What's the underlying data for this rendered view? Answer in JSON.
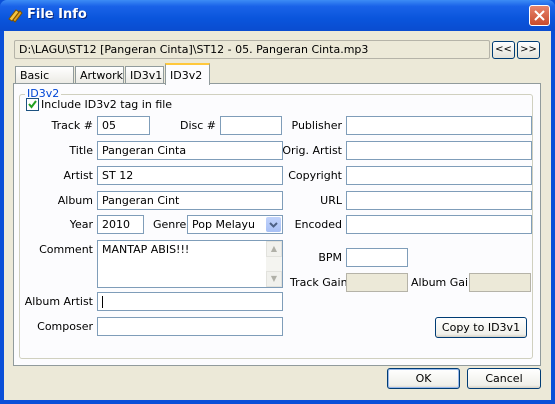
{
  "window": {
    "title": "File Info"
  },
  "path": {
    "value": "D:\\LAGU\\ST12 [Pangeran Cinta]\\ST12 - 05. Pangeran Cinta.mp3"
  },
  "nav": {
    "prev_label": "<<",
    "next_label": ">>"
  },
  "tabs": [
    {
      "label": "Basic Info"
    },
    {
      "label": "Artwork"
    },
    {
      "label": "ID3v1"
    },
    {
      "label": "ID3v2"
    }
  ],
  "active_tab": "ID3v2",
  "group": {
    "label": "ID3v2"
  },
  "include": {
    "label": "Include ID3v2 tag in file",
    "checked": true
  },
  "fields": {
    "track": {
      "label": "Track #",
      "value": "05"
    },
    "disc": {
      "label": "Disc #",
      "value": ""
    },
    "title": {
      "label": "Title",
      "value": "Pangeran Cinta"
    },
    "artist": {
      "label": "Artist",
      "value": "ST 12"
    },
    "album": {
      "label": "Album",
      "value": "Pangeran Cint"
    },
    "year": {
      "label": "Year",
      "value": "2010"
    },
    "genre": {
      "label": "Genre",
      "value": "Pop Melayu"
    },
    "comment": {
      "label": "Comment",
      "value": "MANTAP ABIS!!!"
    },
    "album_artist": {
      "label": "Album Artist",
      "value": ""
    },
    "composer": {
      "label": "Composer",
      "value": ""
    },
    "publisher": {
      "label": "Publisher",
      "value": ""
    },
    "orig_artist": {
      "label": "Orig. Artist",
      "value": ""
    },
    "copyright": {
      "label": "Copyright",
      "value": ""
    },
    "url": {
      "label": "URL",
      "value": ""
    },
    "encoded": {
      "label": "Encoded",
      "value": ""
    },
    "bpm": {
      "label": "BPM",
      "value": ""
    },
    "track_gain": {
      "label": "Track Gain",
      "value": ""
    },
    "album_gain": {
      "label": "Album Gain",
      "value": ""
    }
  },
  "buttons": {
    "copy": "Copy to ID3v1",
    "ok": "OK",
    "cancel": "Cancel"
  },
  "colors": {
    "titlebar": "#0a55dc",
    "accent_tab": "#ffc83c",
    "group_label": "#0046d5"
  }
}
